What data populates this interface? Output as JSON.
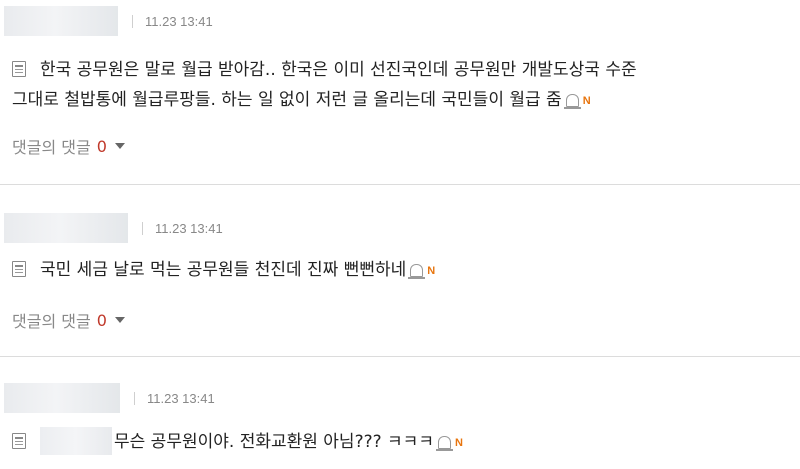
{
  "comments": [
    {
      "time": "11.23 13:41",
      "text_line1": "한국 공무원은 말로 월급 받아감.. 한국은 이미 선진국인데 공무원만 개발도상국 수준",
      "text_line2": "그대로 철밥통에 월급루팡들. 하는 일 없이 저런 글 올리는데 국민들이 월급 줌",
      "badge": "N",
      "reply_label": "댓글의 댓글",
      "reply_count": "0"
    },
    {
      "time": "11.23 13:41",
      "text_line1": "국민 세금 날로 먹는 공무원들 천진데 진짜 뻔뻔하네",
      "badge": "N",
      "reply_label": "댓글의 댓글",
      "reply_count": "0"
    },
    {
      "time": "11.23 13:41",
      "text_line1": "무슨 공무원이야. 전화교환원 아님??? ㅋㅋㅋ",
      "badge": "N"
    }
  ],
  "icons": {
    "document": "document-icon",
    "alarm": "siren-icon",
    "caret": "caret-down-icon"
  },
  "colors": {
    "reply_count": "#c0392b",
    "badge": "#e8750e",
    "divider": "#dcdcdc"
  }
}
